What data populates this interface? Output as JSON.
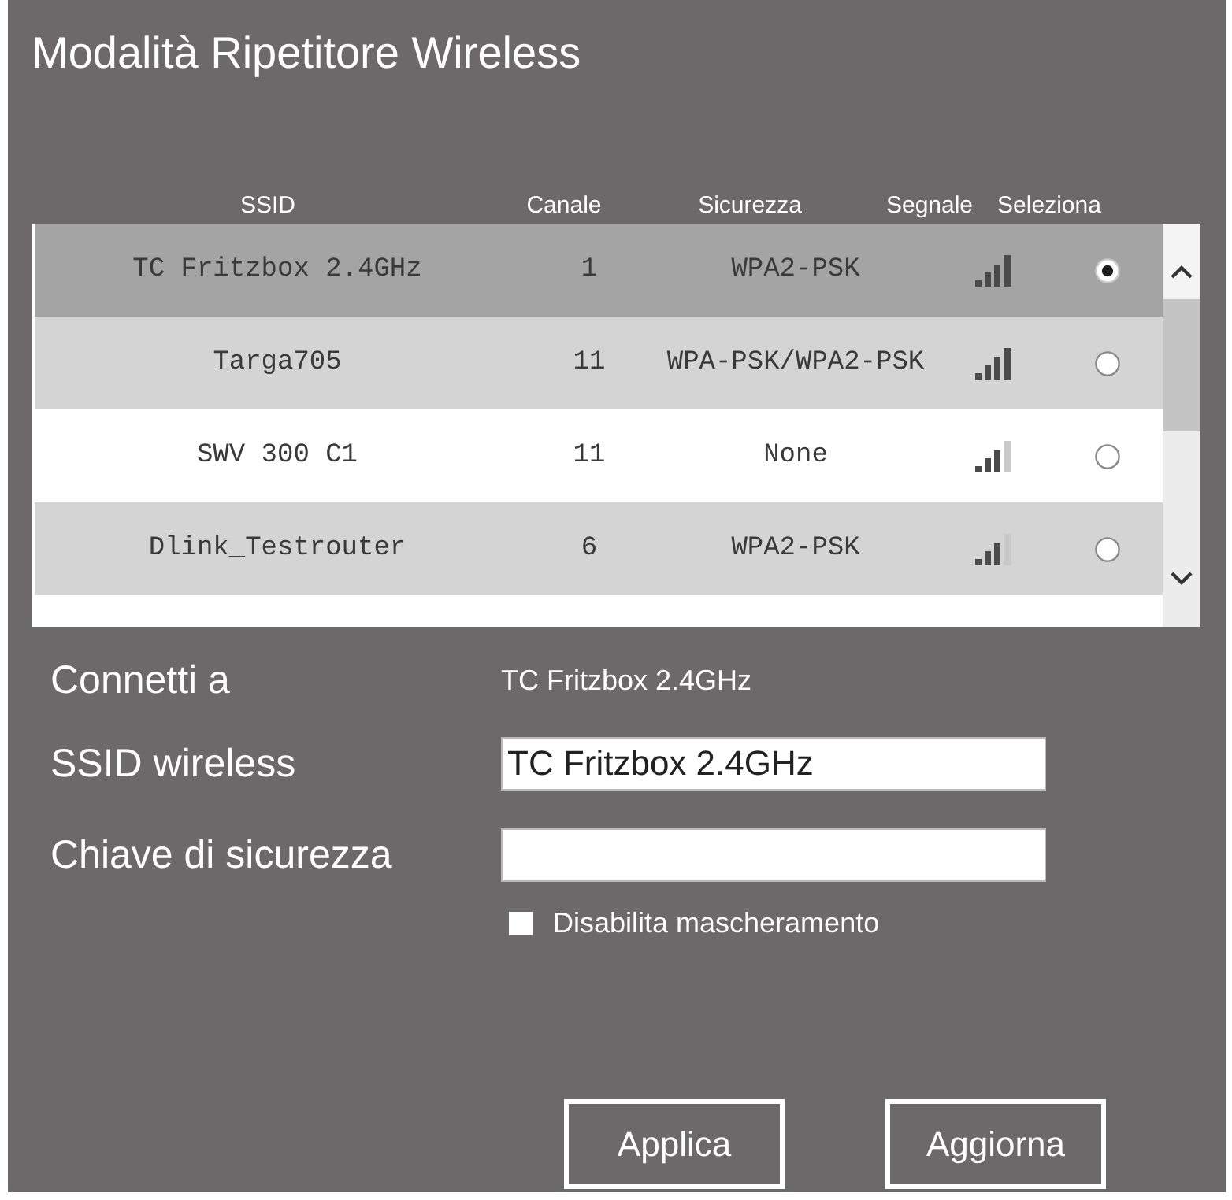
{
  "window": {
    "title": "Modalità Ripetitore Wireless"
  },
  "table": {
    "columns": [
      "SSID",
      "Canale",
      "Sicurezza",
      "Segnale",
      "Seleziona"
    ],
    "rows": [
      {
        "ssid": "TC Fritzbox 2.4GHz",
        "channel": "1",
        "security": "WPA2-PSK",
        "kind": "strong",
        "selected": true
      },
      {
        "ssid": "Targa705",
        "channel": "11",
        "security": "WPA-PSK/WPA2-PSK",
        "kind": "strong",
        "selected": false
      },
      {
        "ssid": "SWV 300 C1",
        "channel": "11",
        "security": "None",
        "kind": "medium",
        "selected": false
      },
      {
        "ssid": "Dlink_Testrouter",
        "channel": "6",
        "security": "WPA2-PSK",
        "kind": "medium",
        "selected": false
      }
    ]
  },
  "form": {
    "connect_to": {
      "label": "Connetti a",
      "value": "TC Fritzbox 2.4GHz"
    },
    "ssid": {
      "label": "SSID wireless",
      "value": "TC Fritzbox 2.4GHz"
    },
    "key": {
      "label": "Chiave di sicurezza"
    },
    "unmask": {
      "label": "Disabilita mascheramento",
      "checked": false
    }
  },
  "buttons": [
    "Applica",
    "Aggiorna"
  ]
}
